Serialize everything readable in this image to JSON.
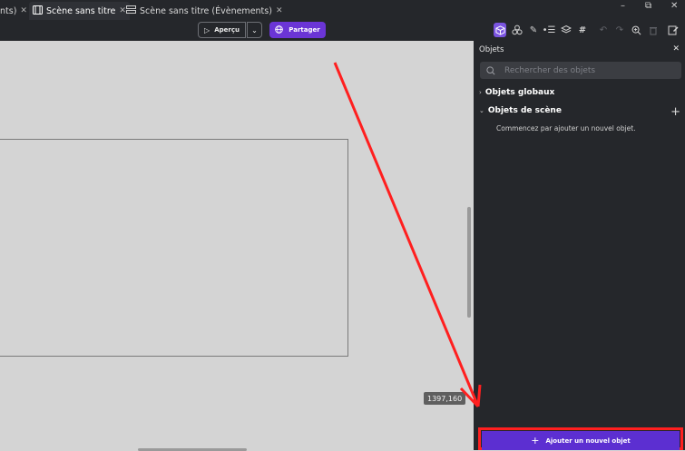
{
  "tabs": [
    {
      "label": "nts)",
      "active": false
    },
    {
      "label": "Scène sans titre",
      "active": true
    },
    {
      "label": "Scène sans titre (Évènements)",
      "active": false
    }
  ],
  "window_controls": {
    "minimize": "–",
    "restore": "⧉",
    "close": "✕"
  },
  "toolbar": {
    "preview_label": "Aperçu",
    "share_label": "Partager",
    "icons": [
      "objects-panel-icon",
      "object-groups-icon",
      "edit-icon",
      "layers-list-icon",
      "layers-icon",
      "grid-icon",
      "undo-icon",
      "redo-icon",
      "zoom-icon",
      "delete-icon",
      "edit-properties-icon"
    ]
  },
  "canvas": {
    "coordinates": "1397,160"
  },
  "objects_panel": {
    "title": "Objets",
    "search_placeholder": "Rechercher des objets",
    "global_objects_label": "Objets globaux",
    "scene_objects_label": "Objets de scène",
    "empty_message": "Commencez par ajouter un nouvel objet.",
    "add_button_label": "Ajouter un nouvel objet"
  },
  "colors": {
    "accent": "#6b35d6",
    "add_button": "#5c2fd1",
    "highlight_annotation": "#ff1f1f",
    "canvas_bg": "#d4d4d4",
    "panel_bg": "#25272b"
  }
}
